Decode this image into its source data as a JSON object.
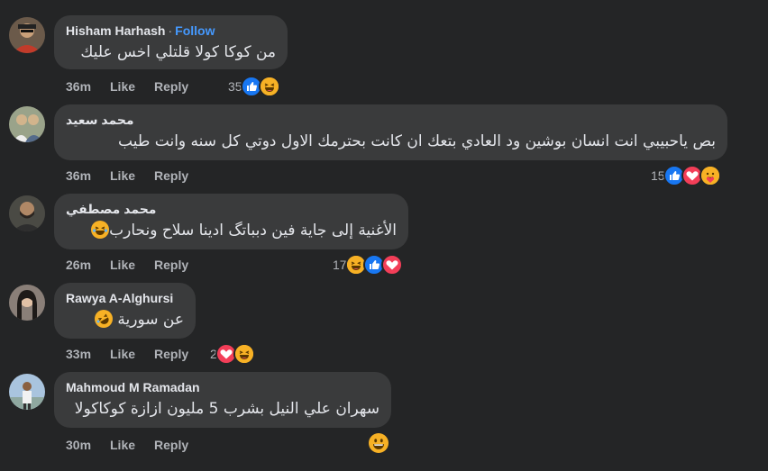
{
  "comments": [
    {
      "author": "Hisham Harhash",
      "separator": "·",
      "follow": "Follow",
      "text": "من كوكا كولا قلتلي اخس عليك",
      "time": "36m",
      "like": "Like",
      "reply": "Reply",
      "reaction_count": "35",
      "reactions": [
        "like-icon",
        "haha-icon"
      ]
    },
    {
      "author": "محمد سعيد",
      "text": "بص ياحبيبي انت انسان بوشين ود العادي بتعك ان كانت بحترمك الاول دوتي كل سنه وانت طيب",
      "time": "36m",
      "like": "Like",
      "reply": "Reply",
      "reaction_count": "15",
      "reactions": [
        "like-icon",
        "love-icon",
        "care-icon"
      ]
    },
    {
      "author": "محمد مصطفي",
      "text": "الأغنية إلى جاية فين دبباتگ ادينا سلاح ونحارب",
      "time": "26m",
      "like": "Like",
      "reply": "Reply",
      "reaction_count": "17",
      "reactions": [
        "haha-icon",
        "like-icon",
        "love-icon"
      ]
    },
    {
      "author": "Rawya A-Alghursi",
      "text": "عن سورية",
      "time": "33m",
      "like": "Like",
      "reply": "Reply",
      "reaction_count": "2",
      "reactions": [
        "love-icon",
        "haha-icon"
      ]
    },
    {
      "author": "Mahmoud M Ramadan",
      "text": "سهران علي النيل بشرب 5 مليون ازازة كوكاكولا",
      "time": "30m",
      "like": "Like",
      "reply": "Reply",
      "reactions": [
        "grin-emoji-icon"
      ]
    }
  ],
  "colors": {
    "background": "#242526",
    "bubble": "#3a3b3c",
    "text": "#e4e6eb",
    "muted": "#b0b3b8",
    "follow": "#4599ff",
    "like": "#1877f2",
    "love": "#f33e58",
    "haha": "#f7b125"
  }
}
